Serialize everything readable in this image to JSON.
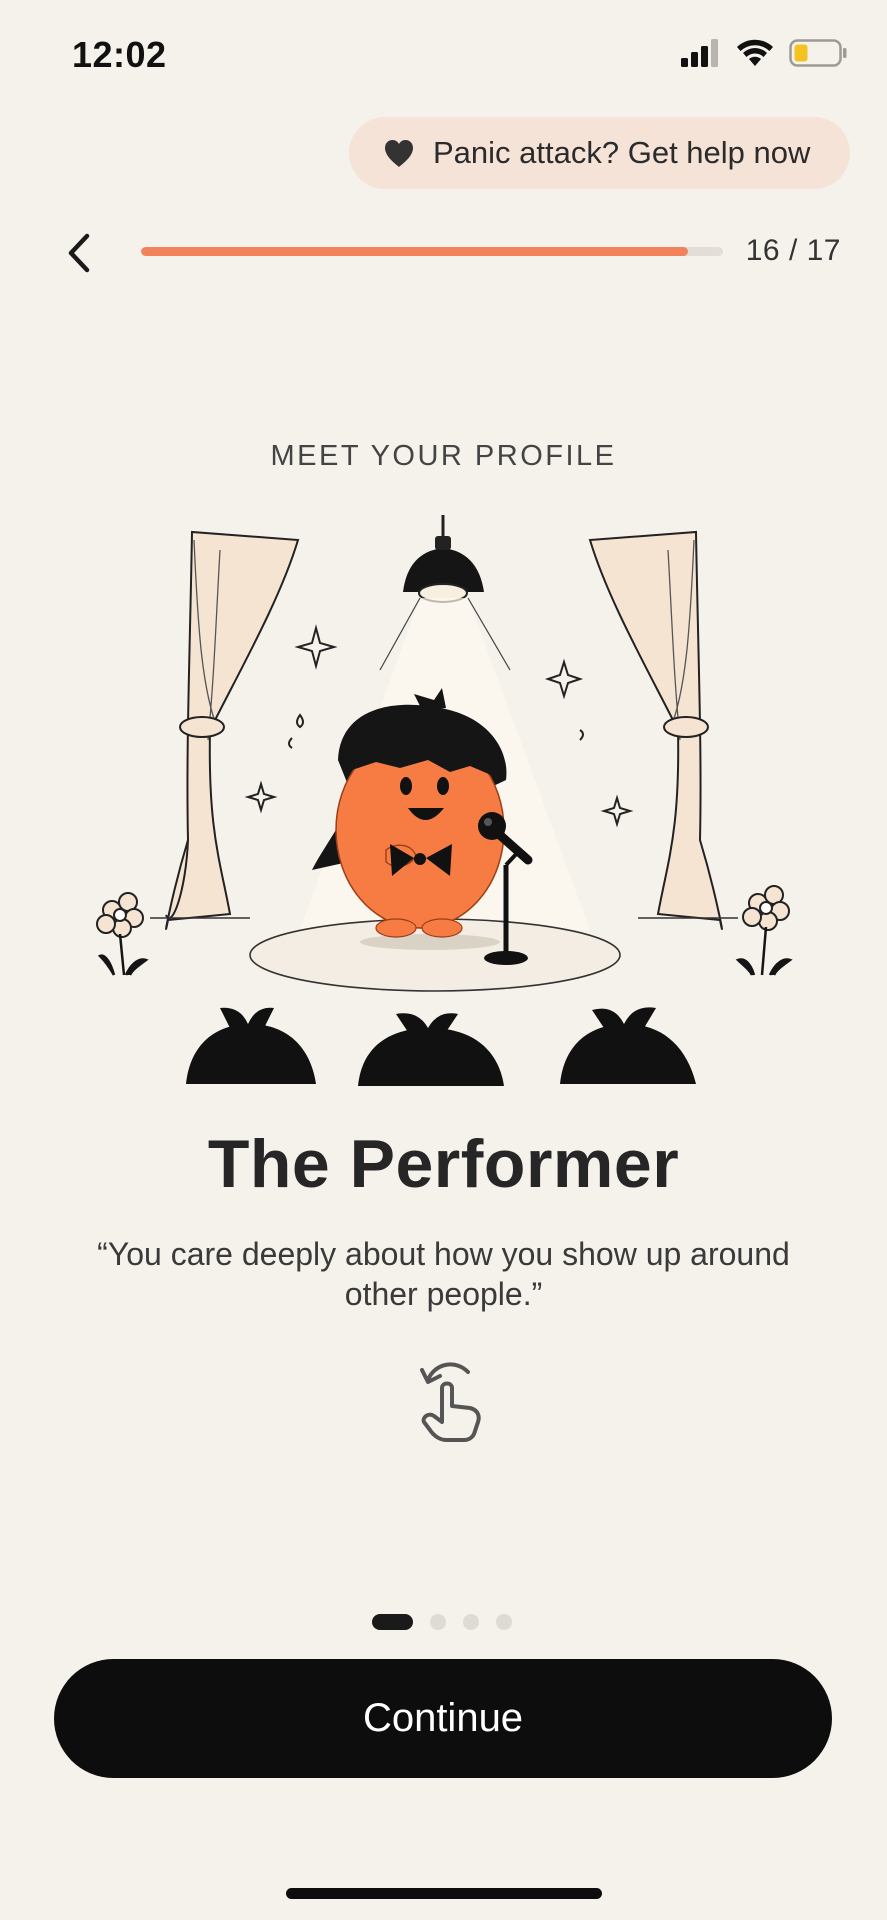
{
  "status_bar": {
    "time": "12:02",
    "icons": [
      "cellular-signal-icon",
      "wifi-icon",
      "battery-icon"
    ],
    "battery_color": "#f4c320"
  },
  "panic_button": {
    "icon": "heart-icon",
    "label": "Panic attack? Get help now",
    "background": "#f6e3d8"
  },
  "nav": {
    "back_icon": "chevron-left-icon",
    "progress": {
      "current": 16,
      "total": 17,
      "fraction": 0.94
    },
    "step_label": "16 / 17",
    "progress_color": "#f2825c"
  },
  "profile": {
    "eyebrow": "MEET YOUR PROFILE",
    "illustration": "performer-on-stage-illustration",
    "title": "The Performer",
    "quote": "“You care deeply about how you show up around other people.”",
    "flip_icon": "tap-to-flip-icon"
  },
  "pagination": {
    "count": 4,
    "active_index": 0
  },
  "continue_button": {
    "label": "Continue"
  },
  "colors": {
    "background": "#f5f1eb",
    "accent": "#f2825c",
    "character": "#f77c44",
    "button": "#0d0d0d"
  }
}
